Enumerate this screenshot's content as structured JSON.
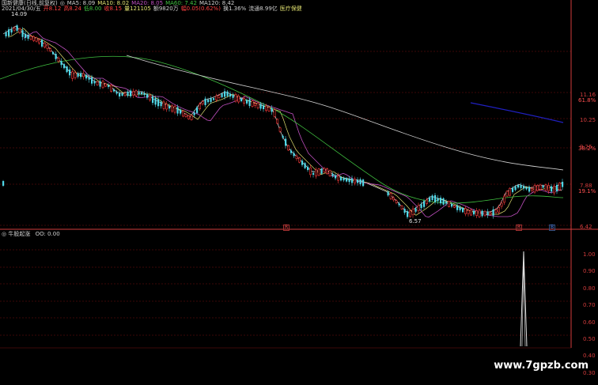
{
  "header": {
    "line1": [
      {
        "text": "国新健康(日线,前复权)",
        "color": "#d0d0d0"
      },
      {
        "text": "◎",
        "color": "#d0d0d0"
      },
      {
        "text": "MA5: 8.09",
        "color": "#d0d0d0"
      },
      {
        "text": "MA10: 8.02",
        "color": "#e0e070"
      },
      {
        "text": "MA20: 8.05",
        "color": "#c050c0"
      },
      {
        "text": "MA60: 7.42",
        "color": "#40c040"
      },
      {
        "text": "MA120: 8.42",
        "color": "#d0d0d0"
      }
    ],
    "line2": [
      {
        "text": "2021/04/30/五",
        "color": "#d0d0d0"
      },
      {
        "text": "开8.12",
        "color": "#ff4040"
      },
      {
        "text": "高8.24",
        "color": "#ff4040"
      },
      {
        "text": "低8.00",
        "color": "#40c040"
      },
      {
        "text": "收8.15",
        "color": "#ff4040"
      },
      {
        "text": "量121105",
        "color": "#e0e070"
      },
      {
        "text": "额9820万",
        "color": "#d0d0d0"
      },
      {
        "text": "幅0.05(0.62%)",
        "color": "#ff4040"
      },
      {
        "text": "换1.36%",
        "color": "#d0d0d0"
      },
      {
        "text": "流通8.99亿",
        "color": "#d0d0d0"
      },
      {
        "text": "医疗保健",
        "color": "#e0e070"
      }
    ]
  },
  "price_axis": {
    "ticks": [
      "11.16",
      "10.25",
      "9.25",
      "7.88",
      "6.42"
    ],
    "pcts": [
      "61.8%",
      "38.2%",
      "19.1%"
    ]
  },
  "annotations": {
    "high": "14.09",
    "low": "6.57"
  },
  "markers": [
    "R",
    "R",
    "B"
  ],
  "indicator": {
    "label": "牛股起涨",
    "value": "OO: 0.00",
    "ticks": [
      "1.00",
      "0.90",
      "0.80",
      "0.70",
      "0.60",
      "0.50",
      "0.40",
      "0.30"
    ]
  },
  "watermark": "www.7gpzb.com",
  "colors": {
    "up": "#ff3c3c",
    "down": "#50d8e8",
    "ma5": "#e0e0e0",
    "ma10": "#e0e070",
    "ma20": "#c050c0",
    "ma60": "#40c040",
    "ma120": "#d0d0d0",
    "blue_line": "#2020c0",
    "grid": "#7a1010",
    "axis": "#d23c3c"
  }
}
